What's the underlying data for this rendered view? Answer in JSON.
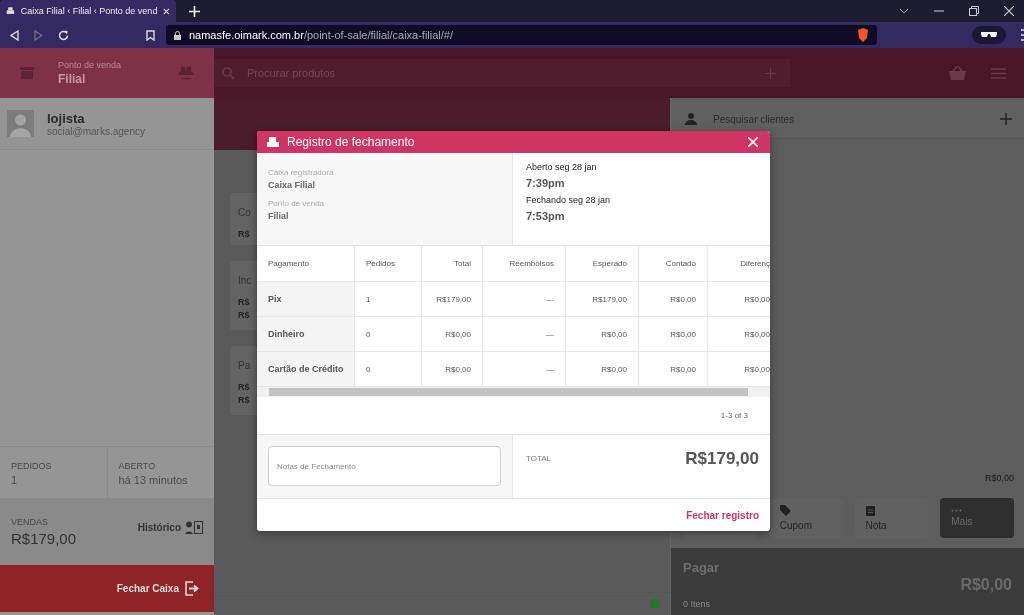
{
  "browser": {
    "tab_title": "Caixa Filial ‹ Filial ‹ Ponto de vend",
    "url_host": "namasfe.oimark.com.br",
    "url_path": "/point-of-sale/filial/caixa-filial/#/"
  },
  "sidebar": {
    "header_label": "Ponto de venda",
    "header_value": "Filial",
    "user": {
      "name": "lojista",
      "email": "social@marks.agency"
    },
    "stats": [
      {
        "label": "PEDIDOS",
        "value": "1"
      },
      {
        "label": "ABERTO",
        "value": "há 13 minutos"
      }
    ],
    "sales": {
      "label": "VENDAS",
      "value": "R$179,00",
      "history": "Histórico"
    },
    "close_button": "Fechar Caixa"
  },
  "topbar": {
    "search_placeholder": "Procurar produtos"
  },
  "product_cards": [
    {
      "title": "Co",
      "prices": [
        "R$"
      ]
    },
    {
      "title": "Inc",
      "prices": [
        "R$",
        "R$"
      ]
    },
    {
      "title": "Pa",
      "prices": [
        "R$",
        "R$"
      ]
    }
  ],
  "customer_panel": {
    "search_placeholder": "Pesquisar clientes",
    "subtotal": "R$0,00",
    "actions": [
      {
        "kind": "tag",
        "label": "Cupom"
      },
      {
        "kind": "note",
        "label": "Nota"
      },
      {
        "kind": "more",
        "label": "Mais"
      }
    ],
    "pay": {
      "label": "Pagar",
      "items": "0 Itens",
      "amount": "R$0,00"
    }
  },
  "modal": {
    "title": "Registro de fechamento",
    "register_label": "Caixa registradora",
    "register_value": "Caixa Filial",
    "pos_label": "Ponto de venda",
    "pos_value": "Filial",
    "opened": {
      "label": "Aberto seg 28 jan",
      "time": "7:39pm"
    },
    "closing": {
      "label": "Fechando seg 28 jan",
      "time": "7:53pm"
    },
    "table": {
      "columns": [
        "Pagamento",
        "Pedidos",
        "Total",
        "Reembolsos",
        "Esperado",
        "Contado",
        "Diferenç"
      ],
      "rows": [
        [
          "Pix",
          "1",
          "R$179,00",
          "—",
          "R$179,00",
          "R$0,00",
          "R$0,00"
        ],
        [
          "Dinheiro",
          "0",
          "R$0,00",
          "—",
          "R$0,00",
          "R$0,00",
          "R$0,00"
        ],
        [
          "Cartão de Crédito",
          "0",
          "R$0,00",
          "—",
          "R$0,00",
          "R$0,00",
          "R$0,00"
        ]
      ]
    },
    "pagination": "1-3 of 3",
    "notes_placeholder": "Notas de Fechamento",
    "total_label": "TOTAL",
    "total_value": "R$179,00",
    "submit": "Fechar registro"
  }
}
